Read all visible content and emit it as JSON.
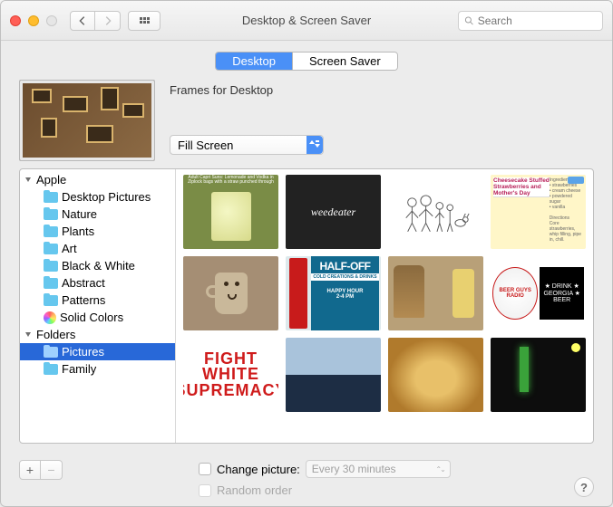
{
  "window": {
    "title": "Desktop & Screen Saver"
  },
  "search": {
    "placeholder": "Search"
  },
  "tabs": {
    "desktop": "Desktop",
    "screensaver": "Screen Saver",
    "active": "desktop"
  },
  "preview": {
    "source_label": "Frames for Desktop"
  },
  "fit_mode": {
    "selected": "Fill Screen"
  },
  "sidebar": {
    "apple_label": "Apple",
    "apple_items": [
      {
        "label": "Desktop Pictures"
      },
      {
        "label": "Nature"
      },
      {
        "label": "Plants"
      },
      {
        "label": "Art"
      },
      {
        "label": "Black & White"
      },
      {
        "label": "Abstract"
      },
      {
        "label": "Patterns"
      },
      {
        "label": "Solid Colors"
      }
    ],
    "folders_label": "Folders",
    "folders_items": [
      {
        "label": "Pictures",
        "selected": true
      },
      {
        "label": "Family"
      }
    ]
  },
  "thumbs": {
    "fight": "FIGHT\nWHITE\nSUPREMACY",
    "halfoff_top": "HALF-OFF",
    "halfoff_sub": "COLD CREATIONS & DRINKS",
    "halfoff_time": "HAPPY HOUR\n2-4 PM",
    "weedeater": "weedeater",
    "beerguys_left": "BEER GUYS RADIO",
    "beerguys_right": "★ DRINK ★ GEORGIA ★ BEER",
    "recipe_title": "Cheesecake Stuffed Strawberries and Mother's Day",
    "recipe_body": "Ingredients\n• strawberries\n• cream cheese\n• powdered sugar\n• vanilla\n\nDirections\nCore strawberries, whip filling, pipe in, chill.",
    "lemonade_caption": "Adult Capri Suns: Lemonade and Vodka in Ziplock bags with a straw punched through"
  },
  "footer": {
    "change_picture_label": "Change picture:",
    "interval_selected": "Every 30 minutes",
    "random_order_label": "Random order",
    "add": "+",
    "remove": "−",
    "help": "?"
  }
}
